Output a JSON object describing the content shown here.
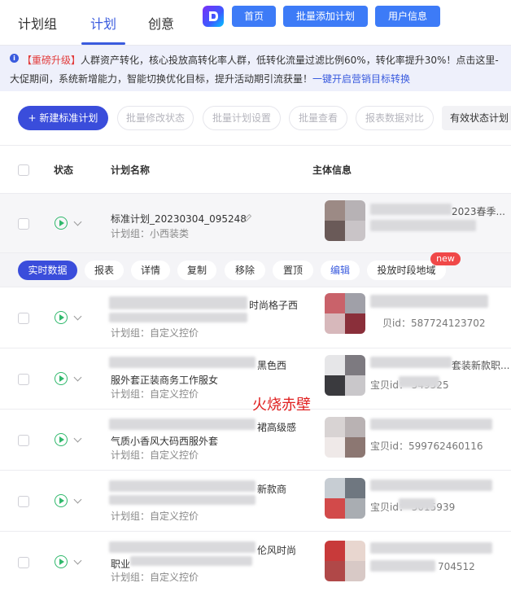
{
  "nav": {
    "tabs": [
      {
        "label": "计划组"
      },
      {
        "label": "计划"
      },
      {
        "label": "创意"
      }
    ],
    "buttons": [
      {
        "label": "首页"
      },
      {
        "label": "批量添加计划"
      },
      {
        "label": "用户信息"
      }
    ]
  },
  "notice": {
    "tag": "【重磅升级】",
    "line1": "人群资产转化，核心投放高转化率人群，低转化流量过滤比例60%，转化率提升30%！点击这里-",
    "line2_prefix": "大促期间，系统新增能力，智能切换优化目标，提升活动期引流获量！",
    "line2_link": "一键开启营销目标转换"
  },
  "actions": {
    "new_plan": "新建标准计划",
    "batch_modify_status": "批量修改状态",
    "batch_plan_settings": "批量计划设置",
    "batch_view": "批量查看",
    "report_compare": "报表数据对比",
    "status_filter": "有效状态计划"
  },
  "table": {
    "headers": {
      "status": "状态",
      "plan_name": "计划名称",
      "subject": "主体信息"
    },
    "rows": [
      {
        "name": "标准计划_20230304_095248",
        "group": "计划组：小西装类",
        "subject_text": "2023春季..."
      },
      {
        "name": "时尚格子西",
        "group": "计划组：自定义控价",
        "subject_text": "贝id：587724123702"
      },
      {
        "name": "黑色西",
        "name2": "服外套正装商务工作服女",
        "group": "计划组：自定义控价",
        "subject_text": "宝贝id：    549525",
        "subject_top": "套装新款职..."
      },
      {
        "name": "裙高级感",
        "name2": "气质小香风大码西服外套",
        "group": "计划组：自定义控价",
        "subject_text": "宝贝id：599762460116"
      },
      {
        "name": "新款商",
        "group": "计划组：自定义控价",
        "subject_text": "宝贝id：    5015939"
      },
      {
        "name": "伦风时尚",
        "name2": "职业",
        "group": "计划组：自定义控价",
        "subject_text": "704512"
      }
    ]
  },
  "sub_actions": {
    "realtime": "实时数据",
    "report": "报表",
    "detail": "详情",
    "copy": "复制",
    "remove": "移除",
    "pin": "置顶",
    "edit": "编辑",
    "schedule_region": "投放时段地域",
    "new_badge": "new"
  },
  "watermark": "火烧赤壁",
  "colors": {
    "accent": "#3a4ddb",
    "link": "#3a5bde",
    "nav_button": "#3d7bf7",
    "status_green": "#2fb86b",
    "warning_red": "#e23c3c"
  }
}
